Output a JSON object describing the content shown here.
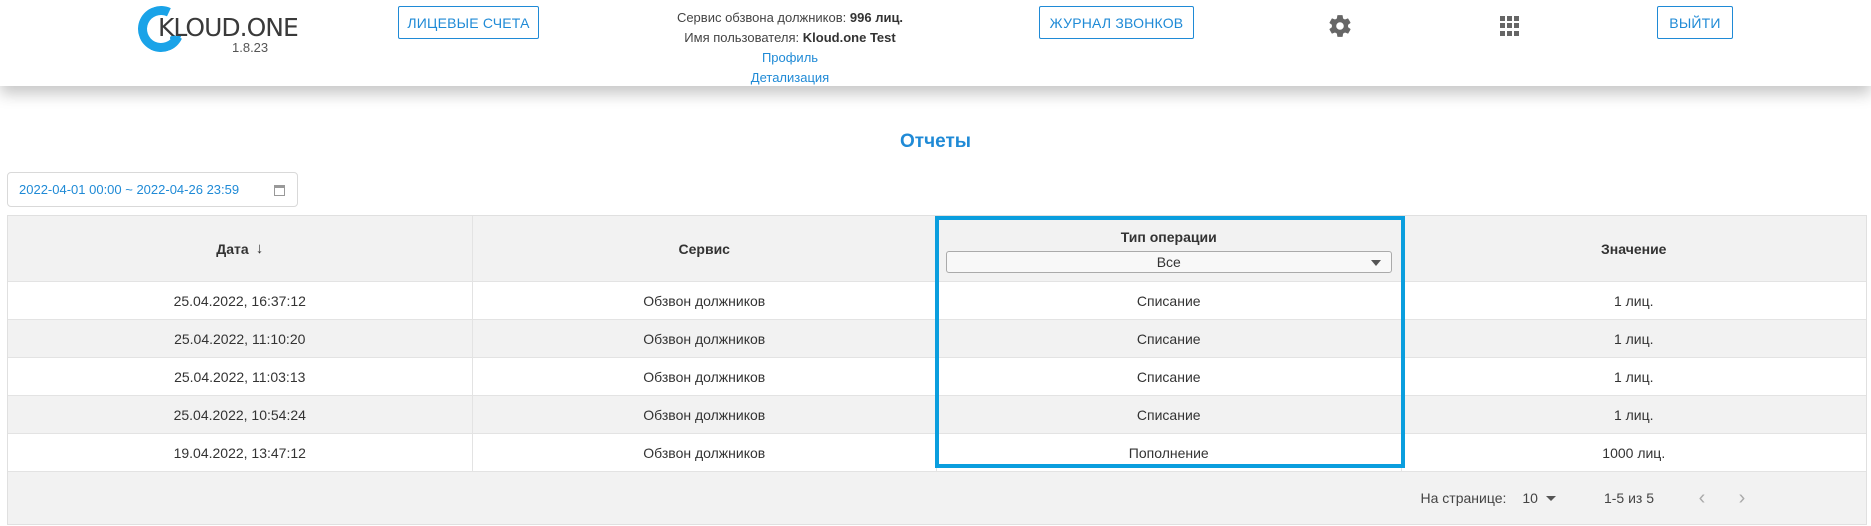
{
  "header": {
    "logo_text": "KLOUD.ONE",
    "version": "1.8.23",
    "accounts_button": "ЛИЦЕВЫЕ СЧЕТА",
    "journal_button": "ЖУРНАЛ ЗВОНКОВ",
    "logout_button": "ВЫЙТИ",
    "service_label": "Сервис обзвона должников:",
    "service_value": "996 лиц.",
    "user_label": "Имя пользователя:",
    "user_value": "Kloud.one Test",
    "profile_link": "Профиль",
    "details_link": "Детализация",
    "settings_icon": "gear-icon",
    "apps_icon": "apps-grid-icon"
  },
  "page": {
    "title": "Отчеты",
    "date_range": "2022-04-01 00:00 ~ 2022-04-26 23:59",
    "date_icon": "calendar-icon"
  },
  "table": {
    "columns": {
      "date": "Дата",
      "date_sort_icon": "↓",
      "service": "Сервис",
      "operation_type": "Тип операции",
      "value": "Значение"
    },
    "filter_value": "Все",
    "rows": [
      {
        "date": "25.04.2022, 16:37:12",
        "service": "Обзвон должников",
        "type": "Списание",
        "value": "1 лиц."
      },
      {
        "date": "25.04.2022, 11:10:20",
        "service": "Обзвон должников",
        "type": "Списание",
        "value": "1 лиц."
      },
      {
        "date": "25.04.2022, 11:03:13",
        "service": "Обзвон должников",
        "type": "Списание",
        "value": "1 лиц."
      },
      {
        "date": "25.04.2022, 10:54:24",
        "service": "Обзвон должников",
        "type": "Списание",
        "value": "1 лиц."
      },
      {
        "date": "19.04.2022, 13:47:12",
        "service": "Обзвон должников",
        "type": "Пополнение",
        "value": "1000 лиц."
      }
    ]
  },
  "pagination": {
    "per_page_label": "На странице:",
    "per_page_value": "10",
    "range": "1-5 из 5",
    "prev": "‹",
    "next": "›"
  },
  "colors": {
    "accent": "#1f8ad6",
    "highlight": "#0a9ede"
  }
}
